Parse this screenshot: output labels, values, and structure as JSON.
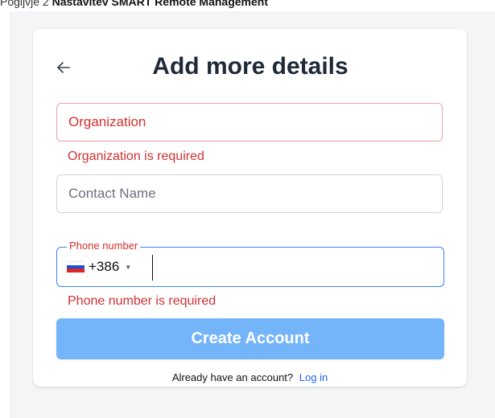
{
  "caption": {
    "prefix": "Pogljvje 2 ",
    "strong": "Nastavitev SMART Remote Management"
  },
  "form": {
    "title": "Add more details",
    "back_icon": "arrow-left-icon",
    "organization": {
      "placeholder": "Organization",
      "value": "",
      "error": "Organization is required"
    },
    "contact": {
      "placeholder": "Contact Name",
      "value": ""
    },
    "phone": {
      "label": "Phone number",
      "dial_code": "+386",
      "flag": "slovenia-flag-icon",
      "value": "",
      "error": "Phone number is required"
    },
    "submit_label": "Create Account",
    "footer_text": "Already have an account?",
    "login_label": "Log in"
  },
  "colors": {
    "error": "#d32f2f",
    "primary_button": "#74b4f9",
    "focus_border": "#3b82f6",
    "link": "#2563eb"
  }
}
